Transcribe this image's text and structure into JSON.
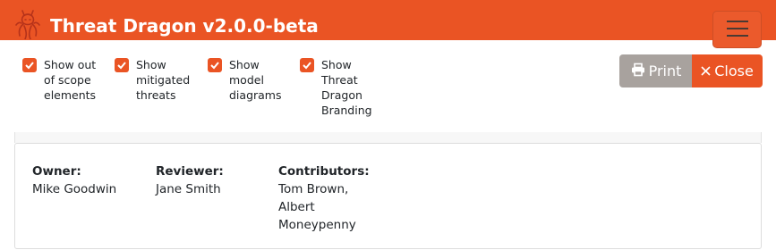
{
  "header": {
    "title": "Threat Dragon v2.0.0-beta",
    "brand_color": "#ea5424"
  },
  "options": [
    {
      "label_lines": [
        "Show out",
        "of scope",
        "elements"
      ],
      "checked": true
    },
    {
      "label_lines": [
        "Show",
        "mitigated",
        "threats"
      ],
      "checked": true
    },
    {
      "label_lines": [
        "Show",
        "model",
        "diagrams"
      ],
      "checked": true
    },
    {
      "label_lines": [
        "Show",
        "Threat",
        "Dragon",
        "Branding"
      ],
      "checked": true
    }
  ],
  "actions": {
    "print_label": "Print",
    "close_label": "Close"
  },
  "model": {
    "owner_label": "Owner:",
    "owner": "Mike Goodwin",
    "reviewer_label": "Reviewer:",
    "reviewer": "Jane Smith",
    "contributors_label": "Contributors:",
    "contributors_lines": [
      "Tom Brown,",
      "Albert",
      "Moneypenny"
    ]
  }
}
